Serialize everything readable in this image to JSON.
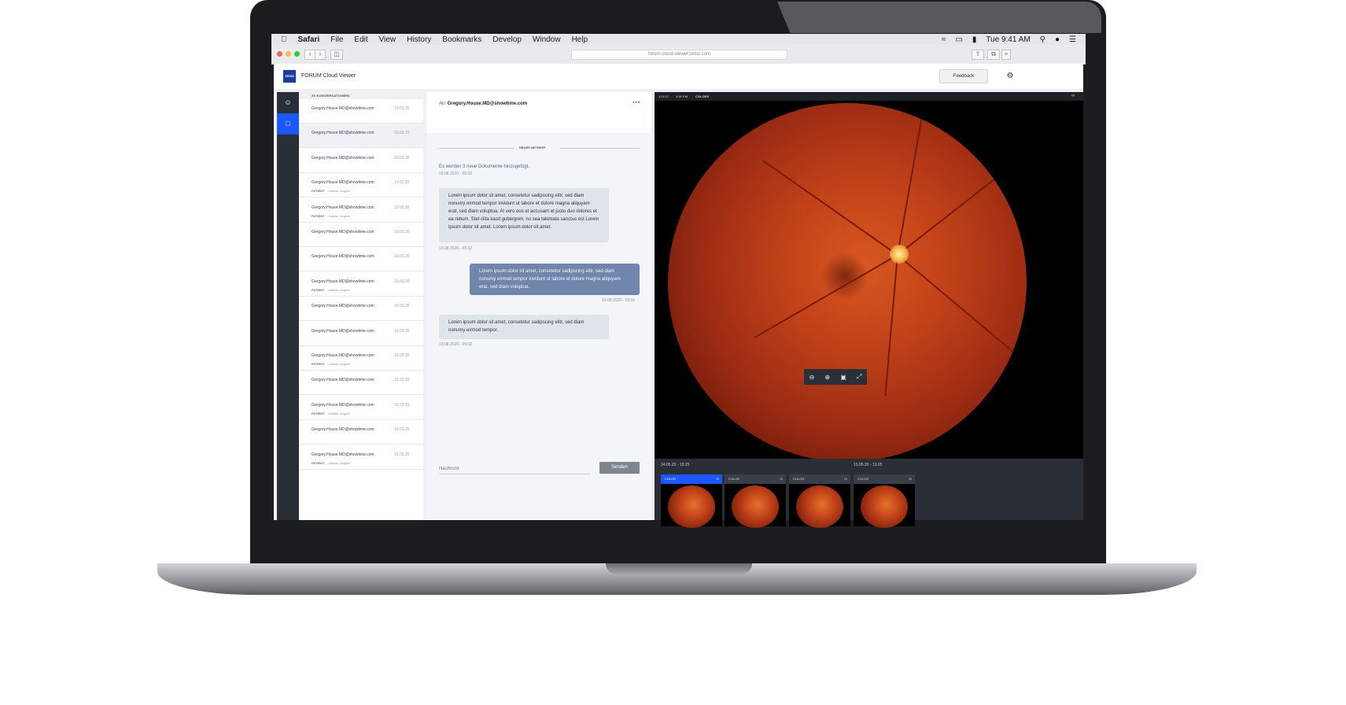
{
  "menubar": {
    "apple": "",
    "app": "Safari",
    "items": [
      "File",
      "Edit",
      "View",
      "History",
      "Bookmarks",
      "Develop",
      "Window",
      "Help"
    ],
    "clock": "Tue 9:41 AM"
  },
  "browser": {
    "url": "forum-cloud-viewer.zeiss.com"
  },
  "app": {
    "logo": "ZEISS",
    "title": "FORUM Cloud Viewer",
    "feedback_label": "Feedback"
  },
  "conversations": {
    "header": "25 KONVERSATIONEN",
    "patient_label": "PATIENT",
    "items": [
      {
        "email": "Gregory.House.MD@showtime.com",
        "date": "10.03.20",
        "patient": ""
      },
      {
        "email": "Gregory.House.MD@showtime.com",
        "date": "10.03.20",
        "patient": ""
      },
      {
        "email": "Gregory.House.MD@showtime.com",
        "date": "10.03.20",
        "patient": ""
      },
      {
        "email": "Gregory.House.MD@showtime.com",
        "date": "10.03.20",
        "patient": "Adams, Angela"
      },
      {
        "email": "Gregory.House.MD@showtime.com",
        "date": "10.03.20",
        "patient": "Adams, Angela"
      },
      {
        "email": "Gregory.House.MD@showtime.com",
        "date": "10.03.20",
        "patient": ""
      },
      {
        "email": "Gregory.House.MD@showtime.com",
        "date": "10.03.20",
        "patient": ""
      },
      {
        "email": "Gregory.House.MD@showtime.com",
        "date": "10.03.20",
        "patient": "Adams, Angela"
      },
      {
        "email": "Gregory.House.MD@showtime.com",
        "date": "10.03.20",
        "patient": ""
      },
      {
        "email": "Gregory.House.MD@showtime.com",
        "date": "10.03.20",
        "patient": ""
      },
      {
        "email": "Gregory.House.MD@showtime.com",
        "date": "10.03.20",
        "patient": "Adams, Angela"
      },
      {
        "email": "Gregory.House.MD@showtime.com",
        "date": "10.03.20",
        "patient": ""
      },
      {
        "email": "Gregory.House.MD@showtime.com",
        "date": "10.03.20",
        "patient": "Adams, Angela"
      },
      {
        "email": "Gregory.House.MD@showtime.com",
        "date": "10.03.20",
        "patient": ""
      },
      {
        "email": "Gregory.House.MD@showtime.com",
        "date": "10.03.20",
        "patient": "Adams, Angela"
      }
    ]
  },
  "chat": {
    "to_label": "An:",
    "to_email": "Gregory.House.MD@showtime.com",
    "divider": "NEUER BETREFF",
    "system_message": "Es wurden 3 neue Dokumente hinzugefügt.",
    "system_time": "19.08.2020 - 09:32",
    "messages": [
      {
        "text": "Lorem ipsum dolor sit amet, consetetur sadipscing elitr, sed diam nonumy eirmod tempor invidunt ut labore et dolore magna aliquyam erat, sed diam voluptua. At vero eos et accusam et justo duo dolores et ea rebum. Stet clita kasd gubergren, no sea takimata sanctus est Lorem ipsum dolor sit amet. Lorem ipsum dolor sit amet.",
        "time": "19.08.2020 - 09:32"
      },
      {
        "text": "Lorem ipsum dolor sit amet, consetetur sadipscing elitr, sed diam nonumy eirmod tempor invidunt ut labore et dolore magna aliquyam erat, sed diam voluptua.",
        "time": "19.08.2020 - 09:32"
      },
      {
        "text": "Lorem ipsum dolor sit amet, consetetur sadipscing elitr, sed diam nonumy eirmod tempor.",
        "time": "19.08.2020 - 09:32"
      }
    ],
    "input_placeholder": "Nachricht",
    "send_label": "Senden"
  },
  "viewer": {
    "date": "1/11/12",
    "time": "3:48 PM",
    "mode": "COLORS",
    "groups": [
      {
        "date": "24.05.20 - 13:25"
      },
      {
        "date": "13.05.20 - 13:25"
      }
    ],
    "thumbs": [
      {
        "label": "COLOR"
      },
      {
        "label": "COLOR"
      },
      {
        "label": "COLOR"
      },
      {
        "label": "COLOR"
      }
    ]
  },
  "colors": {
    "accent": "#1b56ff",
    "outgoing_bubble": "#7186ad",
    "nav_bg": "#2a2f37"
  }
}
